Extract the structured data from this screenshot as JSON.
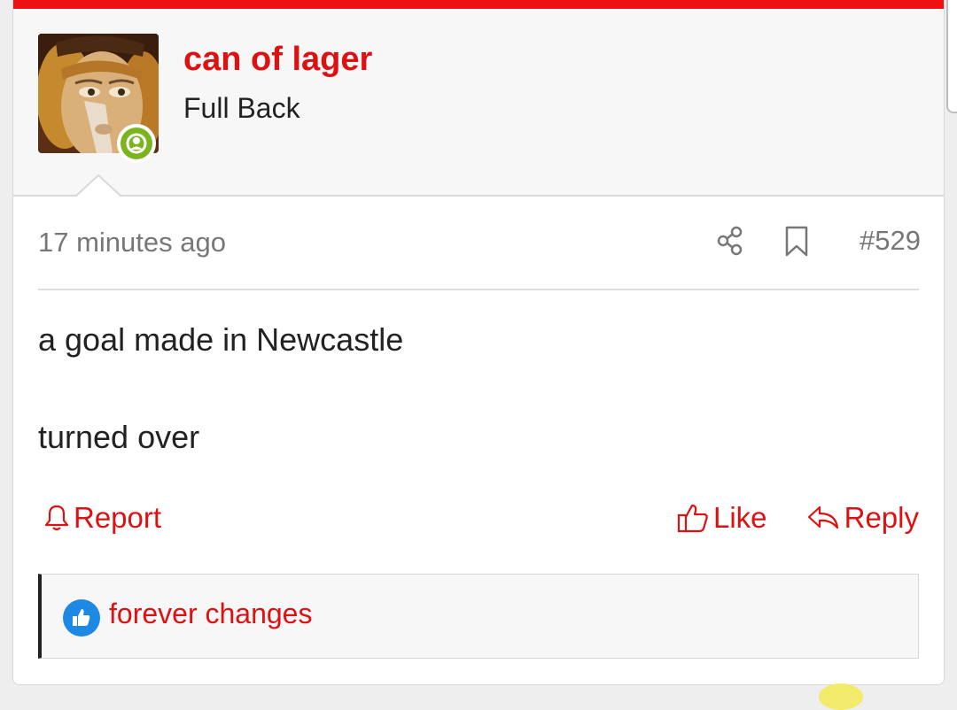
{
  "post": {
    "username": "can of lager",
    "user_title": "Full Back",
    "timestamp": "17 minutes ago",
    "post_number": "#529",
    "message_lines": [
      "a goal made in Newcastle",
      "turned over"
    ],
    "actions": {
      "report": "Report",
      "like": "Like",
      "reply": "Reply"
    },
    "reactions": {
      "reactor": "forever changes",
      "reaction_icon": "thumbs-up-icon"
    },
    "status": "online"
  },
  "colors": {
    "accent": "#dd1111",
    "top_bar": "#ee1111",
    "online": "#7ab51d",
    "like_badge": "#1e88e5",
    "meta_text": "#777777"
  }
}
